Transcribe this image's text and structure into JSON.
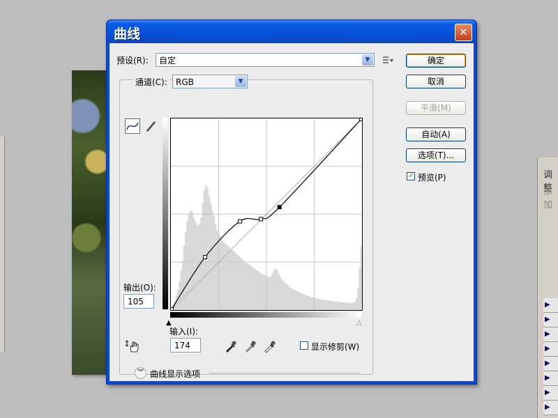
{
  "background": {
    "right_panel_labels": [
      "调整",
      "添加"
    ]
  },
  "dialog": {
    "title": "曲线",
    "preset_label": "预设(R):",
    "preset_value": "自定",
    "channel_label": "通道(C):",
    "channel_value": "RGB",
    "output_label": "输出(O):",
    "output_value": "105",
    "input_label": "输入(I):",
    "input_value": "174",
    "show_clipping_label": "显示修剪(W)",
    "curve_display_options_label": "曲线显示选项",
    "buttons": {
      "ok": "确定",
      "cancel": "取消",
      "smooth": "平滑(M)",
      "auto": "自动(A)",
      "options": "选项(T)..."
    },
    "preview_label": "预览(P)",
    "preview_checked": true,
    "show_clipping_checked": false
  },
  "curve": {
    "points": [
      [
        0,
        0
      ],
      [
        45,
        70
      ],
      [
        92,
        118
      ],
      [
        120,
        121
      ],
      [
        145,
        137
      ],
      [
        255,
        255
      ]
    ],
    "histogram": [
      0,
      8,
      12,
      20,
      28,
      40,
      55,
      70,
      90,
      110,
      125,
      135,
      140,
      138,
      130,
      125,
      120,
      118,
      122,
      130,
      150,
      168,
      175,
      170,
      160,
      150,
      140,
      132,
      120,
      112,
      108,
      104,
      100,
      96,
      94,
      92,
      90,
      88,
      86,
      84,
      82,
      80,
      78,
      76,
      74,
      72,
      70,
      68,
      66,
      65,
      64,
      62,
      60,
      58,
      56,
      55,
      54,
      52,
      50,
      50,
      49,
      48,
      47,
      46,
      48,
      52,
      56,
      58,
      55,
      50,
      45,
      42,
      40,
      38,
      36,
      34,
      32,
      30,
      29,
      28,
      27,
      26,
      25,
      24,
      23,
      22,
      21,
      20,
      20,
      19,
      18,
      18,
      17,
      17,
      16,
      16,
      15,
      15,
      14,
      14,
      14,
      13,
      13,
      13,
      12,
      12,
      12,
      12,
      11,
      11,
      11,
      11,
      10,
      10,
      10,
      10,
      10,
      10,
      12,
      16,
      30,
      60,
      90
    ]
  },
  "colors": {
    "title_bar": "#0a5be6",
    "dialog_body": "#ececec",
    "histogram": "#d8d8d8"
  }
}
